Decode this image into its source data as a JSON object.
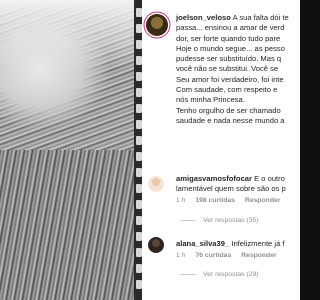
{
  "post": {
    "username": "joelson_veloso",
    "lines": [
      "A sua falta dói te",
      "passa... ensinou a amar de verd",
      "dor, ser forte quando tudo pare",
      "Hoje o mundo segue... as pesso",
      "pudesse ser substituído. Mas q",
      "você não se substitui. Você se",
      "Seu amor foi verdadeiro, foi inte",
      "Com saudade, com respeito e",
      "nós minha Princesa.",
      "Tenho orgulho de ser chamado",
      "saudade e nada nesse mundo a"
    ]
  },
  "comments": [
    {
      "username": "amigasvamosfofocar",
      "text_first": "E o outro",
      "text_second": "lamentável quem sobre são os p",
      "time": "1 h",
      "likes": "198 curtidas",
      "reply": "Responder",
      "view_replies": "Ver respostas (35)"
    },
    {
      "username": "alana_silva39_",
      "text_first": "Infelizmente já f",
      "time": "1 h",
      "likes": "76 curtidas",
      "reply": "Responder",
      "view_replies": "Ver respostas (29)"
    }
  ]
}
